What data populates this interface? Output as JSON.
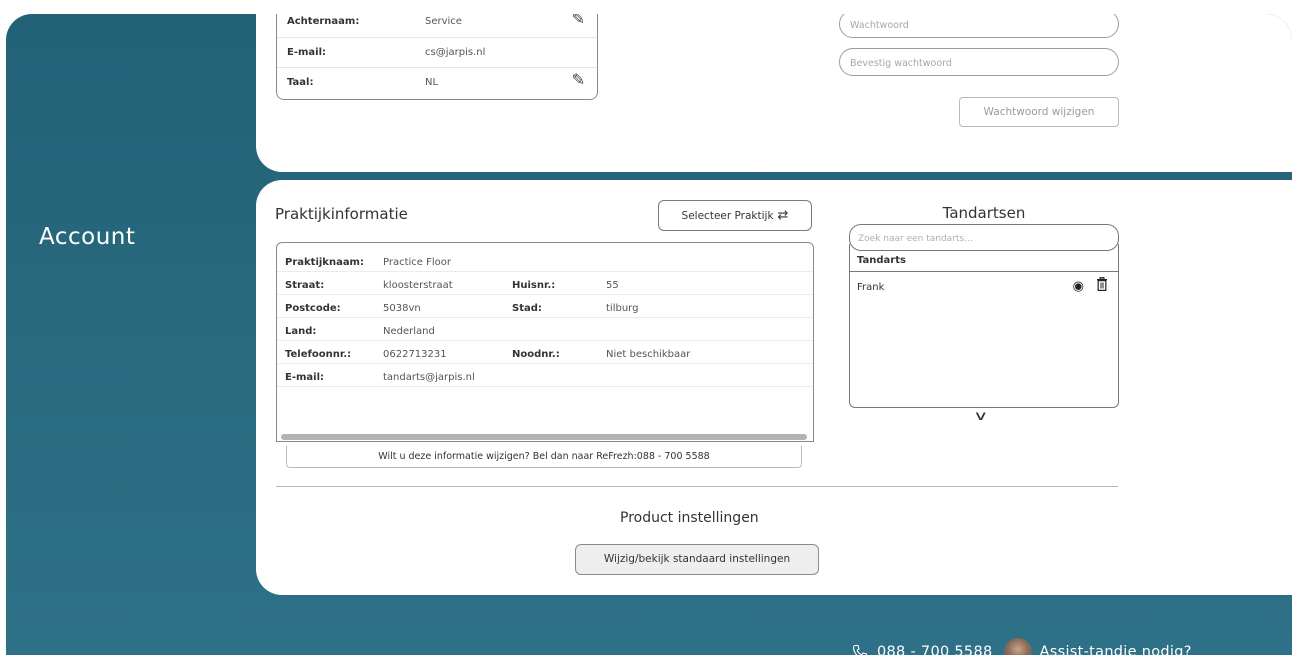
{
  "section": {
    "title": "Account"
  },
  "personal": {
    "rows": [
      {
        "label": "Achternaam:",
        "value": "Service",
        "editable": true
      },
      {
        "label": "E-mail:",
        "value": "cs@jarpis.nl",
        "editable": false
      },
      {
        "label": "Taal:",
        "value": "NL",
        "editable": true
      }
    ]
  },
  "password": {
    "new_placeholder": "Wachtwoord",
    "confirm_placeholder": "Bevestig wachtwoord",
    "change_label": "Wachtwoord wijzigen"
  },
  "praktijk": {
    "title": "Praktijkinformatie",
    "select_label": "Selecteer Praktijk",
    "rows": [
      {
        "label": "Praktijknaam:",
        "value": "Practice Floor",
        "label2": "",
        "value2": ""
      },
      {
        "label": "Straat:",
        "value": "kloosterstraat",
        "label2": "Huisnr.:",
        "value2": "55"
      },
      {
        "label": "Postcode:",
        "value": "5038vn",
        "label2": "Stad:",
        "value2": "tilburg"
      },
      {
        "label": "Land:",
        "value": "Nederland",
        "label2": "",
        "value2": ""
      },
      {
        "label": "Telefoonnr.:",
        "value": "0622713231",
        "label2": "Noodnr.:",
        "value2": "Niet beschikbaar"
      },
      {
        "label": "E-mail:",
        "value": "tandarts@jarpis.nl",
        "label2": "",
        "value2": ""
      }
    ],
    "note": "Wilt u deze informatie wijzigen?   Bel dan naar ReFrezh:088 - 700 5588"
  },
  "product": {
    "title": "Product instellingen",
    "button_label": "Wijzig/bekijk standaard instellingen"
  },
  "tandartsen": {
    "title": "Tandartsen",
    "search_placeholder": "Zoek naar een tandarts...",
    "column_header": "Tandarts",
    "items": [
      {
        "name": "Frank"
      }
    ]
  },
  "footer": {
    "phone": "088 - 700 5588",
    "assist_label": "Assist-tandje nodig?"
  }
}
